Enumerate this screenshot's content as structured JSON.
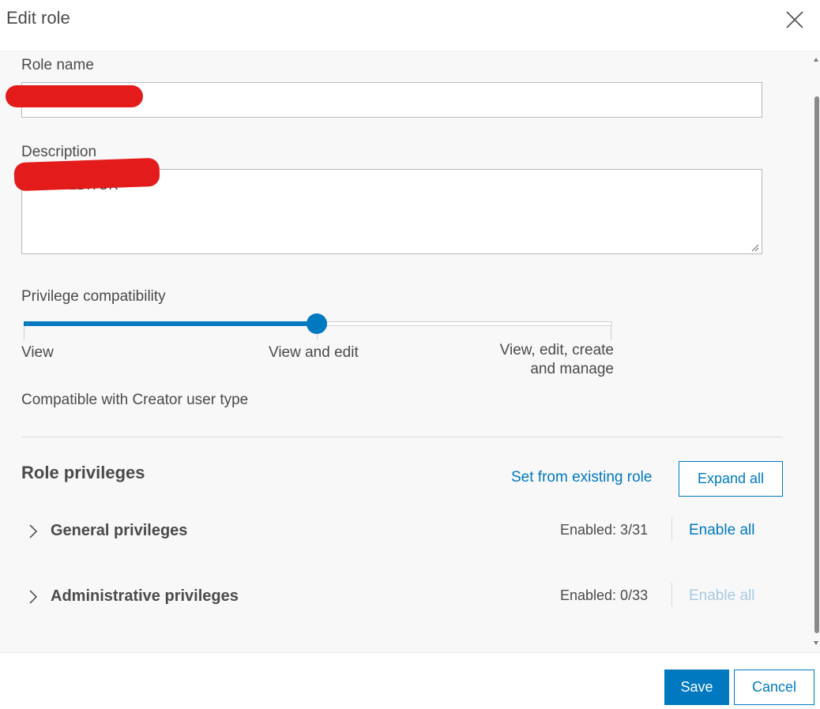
{
  "dialog": {
    "title": "Edit role"
  },
  "form": {
    "role_name_label": "Role name",
    "role_name_value": "",
    "description_label": "Description",
    "description_value": "TEST EDITOR"
  },
  "compatibility": {
    "label": "Privilege compatibility",
    "levels": [
      "View",
      "View and edit",
      "View, edit, create",
      "and manage"
    ],
    "selected_level": 1,
    "note": "Compatible with Creator user type"
  },
  "privileges": {
    "title": "Role privileges",
    "set_from_existing_label": "Set from existing role",
    "expand_all_label": "Expand all",
    "groups": [
      {
        "label": "General privileges",
        "count": "Enabled: 3/31",
        "action": "Enable all",
        "action_enabled": true
      },
      {
        "label": "Administrative privileges",
        "count": "Enabled: 0/33",
        "action": "Enable all",
        "action_enabled": false
      }
    ]
  },
  "footer": {
    "save_label": "Save",
    "cancel_label": "Cancel"
  },
  "colors": {
    "accent": "#0079c1",
    "redaction": "#e31b1b"
  }
}
